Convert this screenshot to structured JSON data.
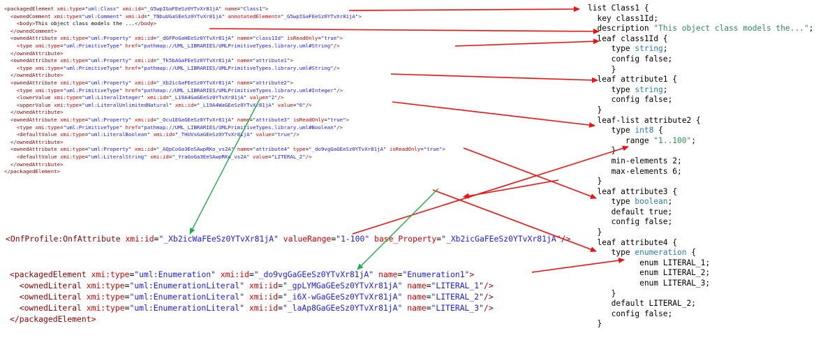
{
  "xml_small": [
    [
      [
        "t",
        "<packagedElement "
      ],
      [
        "a",
        "xmi:type"
      ],
      [
        "p",
        "="
      ],
      [
        "v",
        "\"uml:Class\""
      ],
      [
        "p",
        " "
      ],
      [
        "a",
        "xmi:id"
      ],
      [
        "p",
        "="
      ],
      [
        "v",
        "\"_G5wpIGaFEeSz0YTvXr81jA\""
      ],
      [
        "p",
        " "
      ],
      [
        "a",
        "name"
      ],
      [
        "p",
        "="
      ],
      [
        "v",
        "\"Class1\""
      ],
      [
        "t",
        ">"
      ]
    ],
    [
      [
        "t",
        "  <ownedComment "
      ],
      [
        "a",
        "xmi:type"
      ],
      [
        "p",
        "="
      ],
      [
        "v",
        "\"uml:Comment\""
      ],
      [
        "p",
        " "
      ],
      [
        "a",
        "xmi:id"
      ],
      [
        "p",
        "="
      ],
      [
        "v",
        "\"_TNbuUGaSEeSz0YTvXr81jA\""
      ],
      [
        "p",
        " "
      ],
      [
        "a",
        "annotatedElement"
      ],
      [
        "p",
        "="
      ],
      [
        "v",
        "\"_G5wpIGaFEeSz0YTvXr81jA\""
      ],
      [
        "t",
        ">"
      ]
    ],
    [
      [
        "t",
        "    <body>"
      ],
      [
        "p",
        "This object class models the ..."
      ],
      [
        "t",
        "</body>"
      ]
    ],
    [
      [
        "t",
        "  </ownedComment>"
      ]
    ],
    [
      [
        "t",
        "  <ownedAttribute "
      ],
      [
        "a",
        "xmi:type"
      ],
      [
        "p",
        "="
      ],
      [
        "v",
        "\"uml:Property\""
      ],
      [
        "p",
        " "
      ],
      [
        "a",
        "xmi:id"
      ],
      [
        "p",
        "="
      ],
      [
        "v",
        "\"_dGFPoGaHEeSz0YTvXr81jA\""
      ],
      [
        "p",
        " "
      ],
      [
        "a",
        "name"
      ],
      [
        "p",
        "="
      ],
      [
        "v",
        "\"class1Id\""
      ],
      [
        "p",
        " "
      ],
      [
        "a",
        "isReadOnly"
      ],
      [
        "p",
        "="
      ],
      [
        "v",
        "\"true\""
      ],
      [
        "t",
        ">"
      ]
    ],
    [
      [
        "t",
        "    <type "
      ],
      [
        "a",
        "xmi:type"
      ],
      [
        "p",
        "="
      ],
      [
        "v",
        "\"uml:PrimitiveType\""
      ],
      [
        "p",
        " "
      ],
      [
        "a",
        "href"
      ],
      [
        "p",
        "="
      ],
      [
        "v",
        "\"pathmap://UML_LIBRARIES/UMLPrimitiveTypes.library.uml#String\""
      ],
      [
        "t",
        "/>"
      ]
    ],
    [
      [
        "t",
        "  </ownedAttribute>"
      ]
    ],
    [
      [
        "t",
        "  <ownedAttribute "
      ],
      [
        "a",
        "xmi:type"
      ],
      [
        "p",
        "="
      ],
      [
        "v",
        "\"uml:Property\""
      ],
      [
        "p",
        " "
      ],
      [
        "a",
        "xmi:id"
      ],
      [
        "p",
        "="
      ],
      [
        "v",
        "\"_Tk5bAGaFEeSz0YTvXr81jA\""
      ],
      [
        "p",
        " "
      ],
      [
        "a",
        "name"
      ],
      [
        "p",
        "="
      ],
      [
        "v",
        "\"attribute1\""
      ],
      [
        "t",
        ">"
      ]
    ],
    [
      [
        "t",
        "    <type "
      ],
      [
        "a",
        "xmi:type"
      ],
      [
        "p",
        "="
      ],
      [
        "v",
        "\"uml:PrimitiveType\""
      ],
      [
        "p",
        " "
      ],
      [
        "a",
        "href"
      ],
      [
        "p",
        "="
      ],
      [
        "v",
        "\"pathmap://UML_LIBRARIES/UMLPrimitiveTypes.library.uml#String\""
      ],
      [
        "t",
        "/>"
      ]
    ],
    [
      [
        "t",
        "  </ownedAttribute>"
      ]
    ],
    [
      [
        "t",
        "  <ownedAttribute "
      ],
      [
        "a",
        "xmi:type"
      ],
      [
        "p",
        "="
      ],
      [
        "v",
        "\"uml:Property\""
      ],
      [
        "p",
        " "
      ],
      [
        "a",
        "xmi:id"
      ],
      [
        "p",
        "="
      ],
      [
        "v",
        "\"_Xb2icGaFEeSz0YTvXr81jA\""
      ],
      [
        "p",
        " "
      ],
      [
        "a",
        "name"
      ],
      [
        "p",
        "="
      ],
      [
        "v",
        "\"attribute2\""
      ],
      [
        "t",
        ">"
      ]
    ],
    [
      [
        "t",
        "    <type "
      ],
      [
        "a",
        "xmi:type"
      ],
      [
        "p",
        "="
      ],
      [
        "v",
        "\"uml:PrimitiveType\""
      ],
      [
        "p",
        " "
      ],
      [
        "a",
        "href"
      ],
      [
        "p",
        "="
      ],
      [
        "v",
        "\"pathmap://UML_LIBRARIES/UMLPrimitiveTypes.library.uml#Integer\""
      ],
      [
        "t",
        "/>"
      ]
    ],
    [
      [
        "t",
        "    <lowerValue "
      ],
      [
        "a",
        "xmi:type"
      ],
      [
        "p",
        "="
      ],
      [
        "v",
        "\"uml:LiteralInteger\""
      ],
      [
        "p",
        " "
      ],
      [
        "a",
        "xmi:id"
      ],
      [
        "p",
        "="
      ],
      [
        "v",
        "\"_L19A4GaGEeSz0YTvXr81jA\""
      ],
      [
        "p",
        " "
      ],
      [
        "a",
        "value"
      ],
      [
        "p",
        "="
      ],
      [
        "v",
        "\"2\""
      ],
      [
        "t",
        "/>"
      ]
    ],
    [
      [
        "t",
        "    <upperValue "
      ],
      [
        "a",
        "xmi:type"
      ],
      [
        "p",
        "="
      ],
      [
        "v",
        "\"uml:LiteralUnlimitedNatural\""
      ],
      [
        "p",
        " "
      ],
      [
        "a",
        "xmi:id"
      ],
      [
        "p",
        "="
      ],
      [
        "v",
        "\"_L19A4WaGEeSz0YTvXr81jA\""
      ],
      [
        "p",
        " "
      ],
      [
        "a",
        "value"
      ],
      [
        "p",
        "="
      ],
      [
        "v",
        "\"6\""
      ],
      [
        "t",
        "/>"
      ]
    ],
    [
      [
        "t",
        "  </ownedAttribute>"
      ]
    ],
    [
      [
        "t",
        "  <ownedAttribute "
      ],
      [
        "a",
        "xmi:type"
      ],
      [
        "p",
        "="
      ],
      [
        "v",
        "\"uml:Property\""
      ],
      [
        "p",
        " "
      ],
      [
        "a",
        "xmi:id"
      ],
      [
        "p",
        "="
      ],
      [
        "v",
        "\"_Ocu1EGaGEeSz0YTvXr81jA\""
      ],
      [
        "p",
        " "
      ],
      [
        "a",
        "name"
      ],
      [
        "p",
        "="
      ],
      [
        "v",
        "\"attribute3\""
      ],
      [
        "p",
        " "
      ],
      [
        "a",
        "isReadOnly"
      ],
      [
        "p",
        "="
      ],
      [
        "v",
        "\"true\""
      ],
      [
        "t",
        ">"
      ]
    ],
    [
      [
        "t",
        "    <type "
      ],
      [
        "a",
        "xmi:type"
      ],
      [
        "p",
        "="
      ],
      [
        "v",
        "\"uml:PrimitiveType\""
      ],
      [
        "p",
        " "
      ],
      [
        "a",
        "href"
      ],
      [
        "p",
        "="
      ],
      [
        "v",
        "\"pathmap://UML_LIBRARIES/UMLPrimitiveTypes.library.uml#Boolean\""
      ],
      [
        "t",
        "/>"
      ]
    ],
    [
      [
        "t",
        "    <defaultValue "
      ],
      [
        "a",
        "xmi:type"
      ],
      [
        "p",
        "="
      ],
      [
        "v",
        "\"uml:LiteralBoolean\""
      ],
      [
        "p",
        " "
      ],
      [
        "a",
        "xmi:id"
      ],
      [
        "p",
        "="
      ],
      [
        "v",
        "\"_THUVsGaGEeSz0YTvXr81jA\""
      ],
      [
        "p",
        " "
      ],
      [
        "a",
        "value"
      ],
      [
        "p",
        "="
      ],
      [
        "v",
        "\"true\""
      ],
      [
        "t",
        "/>"
      ]
    ],
    [
      [
        "t",
        "  </ownedAttribute>"
      ]
    ],
    [
      [
        "t",
        "  <ownedAttribute "
      ],
      [
        "a",
        "xmi:type"
      ],
      [
        "p",
        "="
      ],
      [
        "v",
        "\"uml:Property\""
      ],
      [
        "p",
        " "
      ],
      [
        "a",
        "xmi:id"
      ],
      [
        "p",
        "="
      ],
      [
        "v",
        "\"_AQpCoGa3EeSAwpRKo_vs2A\""
      ],
      [
        "p",
        " "
      ],
      [
        "a",
        "name"
      ],
      [
        "p",
        "="
      ],
      [
        "v",
        "\"attribute4\""
      ],
      [
        "p",
        " "
      ],
      [
        "a",
        "type"
      ],
      [
        "p",
        "="
      ],
      [
        "v",
        "\"_do9vgGaGEeSz0YTvXr81jA\""
      ],
      [
        "p",
        " "
      ],
      [
        "a",
        "isReadOnly"
      ],
      [
        "p",
        "="
      ],
      [
        "v",
        "\"true\""
      ],
      [
        "t",
        ">"
      ]
    ],
    [
      [
        "t",
        "    <defaultValue "
      ],
      [
        "a",
        "xmi:type"
      ],
      [
        "p",
        "="
      ],
      [
        "v",
        "\"uml:LiteralString\""
      ],
      [
        "p",
        " "
      ],
      [
        "a",
        "xmi:id"
      ],
      [
        "p",
        "="
      ],
      [
        "v",
        "\"_YraGoGa3EeSAwpRKo_vs2A\""
      ],
      [
        "p",
        " "
      ],
      [
        "a",
        "value"
      ],
      [
        "p",
        "="
      ],
      [
        "v",
        "\"LITERAL_2\""
      ],
      [
        "t",
        "/>"
      ]
    ],
    [
      [
        "t",
        "  </ownedAttribute>"
      ]
    ],
    [
      [
        "t",
        "</packagedElement>"
      ]
    ]
  ],
  "xml_profile": [
    [
      [
        "t",
        "<OnfProfile:OnfAttribute "
      ],
      [
        "a",
        "xmi:id"
      ],
      [
        "p",
        "="
      ],
      [
        "v",
        "\"_Xb2icWaFEeSz0YTvXr81jA\""
      ],
      [
        "p",
        " "
      ],
      [
        "a",
        "valueRange"
      ],
      [
        "p",
        "="
      ],
      [
        "v",
        "\"1-100\""
      ],
      [
        "p",
        " "
      ],
      [
        "a",
        "base_Property"
      ],
      [
        "p",
        "="
      ],
      [
        "v",
        "\"_Xb2icGaFEeSz0YTvXr81jA\""
      ],
      [
        "t",
        "/>"
      ]
    ]
  ],
  "xml_enum": [
    [
      [
        "t",
        "<packagedElement "
      ],
      [
        "a",
        "xmi:type"
      ],
      [
        "p",
        "="
      ],
      [
        "v",
        "\"uml:Enumeration\""
      ],
      [
        "p",
        " "
      ],
      [
        "a",
        "xmi:id"
      ],
      [
        "p",
        "="
      ],
      [
        "v",
        "\"_do9vgGaGEeSz0YTvXr81jA\""
      ],
      [
        "p",
        " "
      ],
      [
        "a",
        "name"
      ],
      [
        "p",
        "="
      ],
      [
        "v",
        "\"Enumeration1\""
      ],
      [
        "t",
        ">"
      ]
    ],
    [
      [
        "t",
        "  <ownedLiteral "
      ],
      [
        "a",
        "xmi:type"
      ],
      [
        "p",
        "="
      ],
      [
        "v",
        "\"uml:EnumerationLiteral\""
      ],
      [
        "p",
        " "
      ],
      [
        "a",
        "xmi:id"
      ],
      [
        "p",
        "="
      ],
      [
        "v",
        "\"_gpLYMGaGEeSz0YTvXr81jA\""
      ],
      [
        "p",
        " "
      ],
      [
        "a",
        "name"
      ],
      [
        "p",
        "="
      ],
      [
        "v",
        "\"LITERAL_1\""
      ],
      [
        "t",
        "/>"
      ]
    ],
    [
      [
        "t",
        "  <ownedLiteral "
      ],
      [
        "a",
        "xmi:type"
      ],
      [
        "p",
        "="
      ],
      [
        "v",
        "\"uml:EnumerationLiteral\""
      ],
      [
        "p",
        " "
      ],
      [
        "a",
        "xmi:id"
      ],
      [
        "p",
        "="
      ],
      [
        "v",
        "\"_i6X-wGaGEeSz0YTvXr81jA\""
      ],
      [
        "p",
        " "
      ],
      [
        "a",
        "name"
      ],
      [
        "p",
        "="
      ],
      [
        "v",
        "\"LITERAL_2\""
      ],
      [
        "t",
        "/>"
      ]
    ],
    [
      [
        "t",
        "  <ownedLiteral "
      ],
      [
        "a",
        "xmi:type"
      ],
      [
        "p",
        "="
      ],
      [
        "v",
        "\"uml:EnumerationLiteral\""
      ],
      [
        "p",
        " "
      ],
      [
        "a",
        "xmi:id"
      ],
      [
        "p",
        "="
      ],
      [
        "v",
        "\"_laAp8GaGEeSz0YTvXr81jA\""
      ],
      [
        "p",
        " "
      ],
      [
        "a",
        "name"
      ],
      [
        "p",
        "="
      ],
      [
        "v",
        "\"LITERAL_3\""
      ],
      [
        "t",
        "/>"
      ]
    ],
    [
      [
        "t",
        "</packagedElement>"
      ]
    ]
  ],
  "yang": [
    [
      [
        "kw",
        "list Class1 {"
      ]
    ],
    [
      [
        "kw",
        "  key class1Id;"
      ]
    ],
    [
      [
        "kw",
        "  description "
      ],
      [
        "st",
        "\"This object class models the...\""
      ],
      [
        "kw",
        ";"
      ]
    ],
    [
      [
        "kw",
        "  leaf class1Id {"
      ]
    ],
    [
      [
        "kw",
        "     type "
      ],
      [
        "ty",
        "string"
      ],
      [
        "kw",
        ";"
      ]
    ],
    [
      [
        "kw",
        "     config false;"
      ]
    ],
    [
      [
        "kw",
        "     }"
      ]
    ],
    [
      [
        "kw",
        "  leaf attribute1 {"
      ]
    ],
    [
      [
        "kw",
        "     type "
      ],
      [
        "ty",
        "string"
      ],
      [
        "kw",
        ";"
      ]
    ],
    [
      [
        "kw",
        "     config false;"
      ]
    ],
    [
      [
        "kw",
        "  }"
      ]
    ],
    [
      [
        "kw",
        "  leaf-list attribute2 {"
      ]
    ],
    [
      [
        "kw",
        "     type "
      ],
      [
        "ty",
        "int8"
      ],
      [
        "kw",
        " {"
      ]
    ],
    [
      [
        "kw",
        "        range "
      ],
      [
        "st",
        "\"1..100\""
      ],
      [
        "kw",
        ";"
      ]
    ],
    [
      [
        "kw",
        "     }"
      ]
    ],
    [
      [
        "kw",
        "     min-elements 2;"
      ]
    ],
    [
      [
        "kw",
        "     max-elements 6;"
      ]
    ],
    [
      [
        "kw",
        "  }"
      ]
    ],
    [
      [
        "kw",
        "  leaf attribute3 {"
      ]
    ],
    [
      [
        "kw",
        "     type "
      ],
      [
        "ty",
        "boolean"
      ],
      [
        "kw",
        ";"
      ]
    ],
    [
      [
        "kw",
        "     default true;"
      ]
    ],
    [
      [
        "kw",
        "     config false;"
      ]
    ],
    [
      [
        "kw",
        "  }"
      ]
    ],
    [
      [
        "kw",
        "  leaf attribute4 {"
      ]
    ],
    [
      [
        "kw",
        "     type "
      ],
      [
        "ty",
        "enumeration"
      ],
      [
        "kw",
        " {"
      ]
    ],
    [
      [
        "kw",
        "           enum LITERAL_1;"
      ]
    ],
    [
      [
        "kw",
        "           enum LITERAL_2;"
      ]
    ],
    [
      [
        "kw",
        "           enum LITERAL_3;"
      ]
    ],
    [
      [
        "kw",
        "     }"
      ]
    ],
    [
      [
        "kw",
        "     default LITERAL_2;"
      ]
    ],
    [
      [
        "kw",
        "     config false;"
      ]
    ],
    [
      [
        "kw",
        "  }"
      ]
    ]
  ],
  "colors": {
    "mapping_arrow": "#ee1111",
    "reference_arrow": "#22aa44"
  }
}
